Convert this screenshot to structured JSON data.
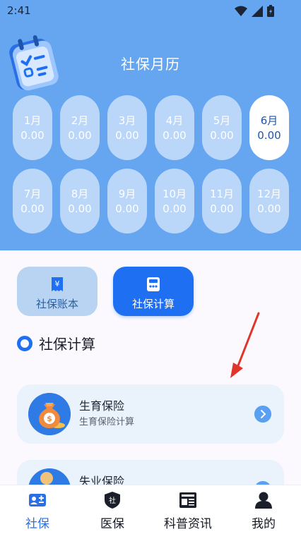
{
  "status_bar": {
    "time": "2:41"
  },
  "hero": {
    "title": "社保月历",
    "months": [
      {
        "label": "1月",
        "value": "0.00",
        "active": false
      },
      {
        "label": "2月",
        "value": "0.00",
        "active": false
      },
      {
        "label": "3月",
        "value": "0.00",
        "active": false
      },
      {
        "label": "4月",
        "value": "0.00",
        "active": false
      },
      {
        "label": "5月",
        "value": "0.00",
        "active": false
      },
      {
        "label": "6月",
        "value": "0.00",
        "active": true
      },
      {
        "label": "7月",
        "value": "0.00",
        "active": false
      },
      {
        "label": "8月",
        "value": "0.00",
        "active": false
      },
      {
        "label": "9月",
        "value": "0.00",
        "active": false
      },
      {
        "label": "10月",
        "value": "0.00",
        "active": false
      },
      {
        "label": "11月",
        "value": "0.00",
        "active": false
      },
      {
        "label": "12月",
        "value": "0.00",
        "active": false
      }
    ]
  },
  "quick": {
    "ledger_label": "社保账本",
    "calc_label": "社保计算"
  },
  "section": {
    "title": "社保计算"
  },
  "cards": [
    {
      "title": "生育保险",
      "subtitle": "生育保险计算"
    },
    {
      "title": "失业保险",
      "subtitle": ""
    }
  ],
  "tabs": [
    {
      "label": "社保",
      "icon": "id-card-icon",
      "active": true
    },
    {
      "label": "医保",
      "icon": "shield-icon",
      "active": false
    },
    {
      "label": "科普资讯",
      "icon": "news-icon",
      "active": false
    },
    {
      "label": "我的",
      "icon": "person-icon",
      "active": false
    }
  ],
  "colors": {
    "hero_blue": "#66a5f0",
    "primary_blue": "#1f6ff2",
    "annotation_red": "#e0352b",
    "active_tab": "#2a6fe6"
  }
}
